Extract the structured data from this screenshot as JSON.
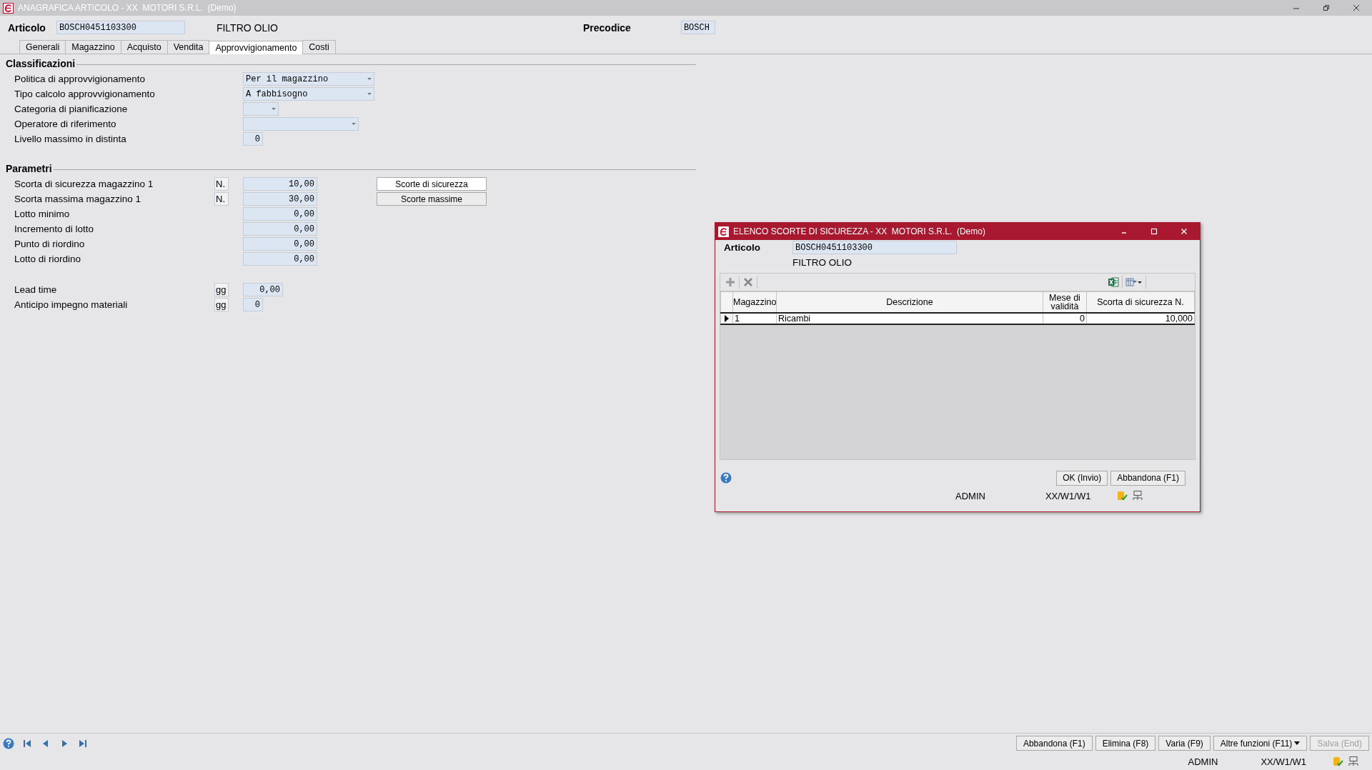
{
  "window": {
    "title": "ANAGRAFICA ARTICOLO - XX  MOTORI S.R.L.  (Demo)"
  },
  "header": {
    "articolo_label": "Articolo",
    "articolo_value": "BOSCH0451103300",
    "description": "FILTRO OLIO",
    "precodice_label": "Precodice",
    "precodice_value": "BOSCH"
  },
  "tabs": [
    {
      "label": "Generali",
      "selected": false
    },
    {
      "label": "Magazzino",
      "selected": false
    },
    {
      "label": "Acquisto",
      "selected": false
    },
    {
      "label": "Vendita",
      "selected": false
    },
    {
      "label": "Approvvigionamento",
      "selected": true
    },
    {
      "label": "Costi",
      "selected": false
    }
  ],
  "sections": [
    {
      "title": "Classificazioni",
      "groups": [
        [
          {
            "kind": "combo",
            "label": "Politica di approvvigionamento",
            "value": "Per il magazzino"
          },
          {
            "kind": "combo",
            "label": "Tipo calcolo approvvigionamento",
            "value": "A fabbisogno"
          },
          {
            "kind": "shortcombo",
            "label": "Categoria di pianificazione"
          },
          {
            "kind": "midcombo",
            "label": "Operatore di riferimento"
          },
          {
            "kind": "tinynumber",
            "label": "Livello massimo in distinta",
            "value": "0"
          }
        ]
      ]
    },
    {
      "title": "Parametri",
      "groups": [
        [
          {
            "kind": "number",
            "label": "Scorta di sicurezza magazzino 1",
            "unit": "N.",
            "value": "10,00",
            "button": "Scorte di sicurezza"
          },
          {
            "kind": "number",
            "label": "Scorta massima magazzino 1",
            "unit": "N.",
            "value": "30,00",
            "button": "Scorte massime"
          },
          {
            "kind": "number",
            "label": "Lotto minimo",
            "value": "0,00"
          },
          {
            "kind": "number",
            "label": "Incremento di lotto",
            "value": "0,00"
          },
          {
            "kind": "number",
            "label": "Punto di riordino",
            "value": "0,00"
          },
          {
            "kind": "number",
            "label": "Lotto di riordino",
            "value": "0,00"
          }
        ],
        [
          {
            "kind": "shortnumber",
            "label": "Lead time",
            "unit": "gg",
            "value": "0,00"
          },
          {
            "kind": "tinynumber",
            "label": "Anticipo impegno materiali",
            "unit": "gg",
            "value": "0"
          }
        ]
      ]
    }
  ],
  "dialog": {
    "title": "ELENCO SCORTE DI SICUREZZA - XX  MOTORI S.R.L.  (Demo)",
    "articolo_label": "Articolo",
    "articolo_value": "BOSCH0451103300",
    "description": "FILTRO OLIO",
    "table": {
      "columns": [
        "Magazzino",
        "Descrizione",
        "Mese di validità",
        "Scorta di sicurezza N."
      ],
      "rows": [
        {
          "cells": [
            "1",
            "Ricambi",
            "0",
            "10,000"
          ],
          "selected": true
        }
      ]
    },
    "buttons": [
      "OK (Invio)",
      "Abbandona (F1)"
    ],
    "status": {
      "user": "ADMIN",
      "path": "XX/W1/W1"
    }
  },
  "bottom_buttons": [
    {
      "label": "Abbandona (F1)",
      "kind": "plain",
      "disabled": false
    },
    {
      "label": "Elimina (F8)",
      "kind": "plain",
      "disabled": false
    },
    {
      "label": "Varia (F9)",
      "kind": "plain",
      "disabled": false
    },
    {
      "label": "Altre funzioni (F11)",
      "kind": "dropdown",
      "disabled": false
    },
    {
      "label": "Salva (End)",
      "kind": "plain",
      "disabled": true
    }
  ],
  "status_bar": {
    "user": "ADMIN",
    "path": "XX/W1/W1"
  }
}
